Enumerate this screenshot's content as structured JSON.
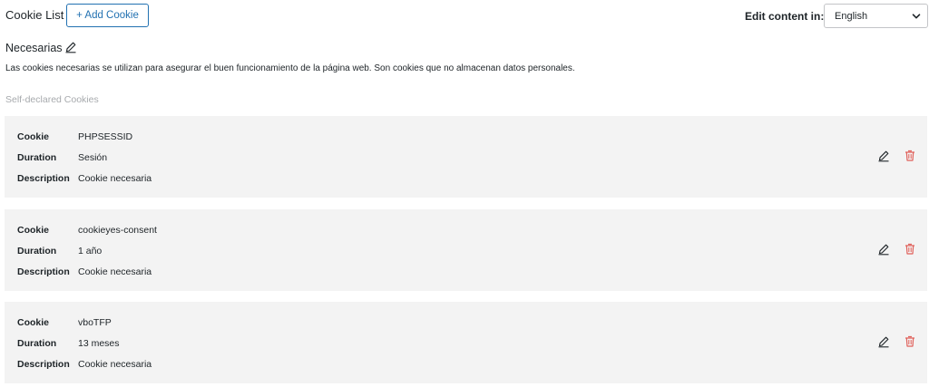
{
  "header": {
    "title": "Cookie List",
    "add_button_label": "+ Add Cookie",
    "edit_content_label": "Edit content in:",
    "language_selected": "English"
  },
  "category": {
    "name": "Necesarias",
    "description": "Las cookies necesarias se utilizan para asegurar el buen funcionamiento de la página web. Son cookies que no almacenan datos personales.",
    "section_label": "Self-declared Cookies"
  },
  "field_labels": {
    "cookie": "Cookie",
    "duration": "Duration",
    "description": "Description"
  },
  "cookies": [
    {
      "name": "PHPSESSID",
      "duration": "Sesión",
      "description": "Cookie necesaria"
    },
    {
      "name": "cookieyes-consent",
      "duration": "1 año",
      "description": "Cookie necesaria"
    },
    {
      "name": "vboTFP",
      "duration": "13 meses",
      "description": "Cookie necesaria"
    }
  ],
  "colors": {
    "accent": "#2271b1",
    "delete": "#e0605a",
    "card_bg": "#f3f3f3",
    "muted_text": "#a7aaad"
  },
  "icons": {
    "edit": "pencil-icon",
    "delete": "trash-icon",
    "dropdown": "chevron-down-icon"
  }
}
